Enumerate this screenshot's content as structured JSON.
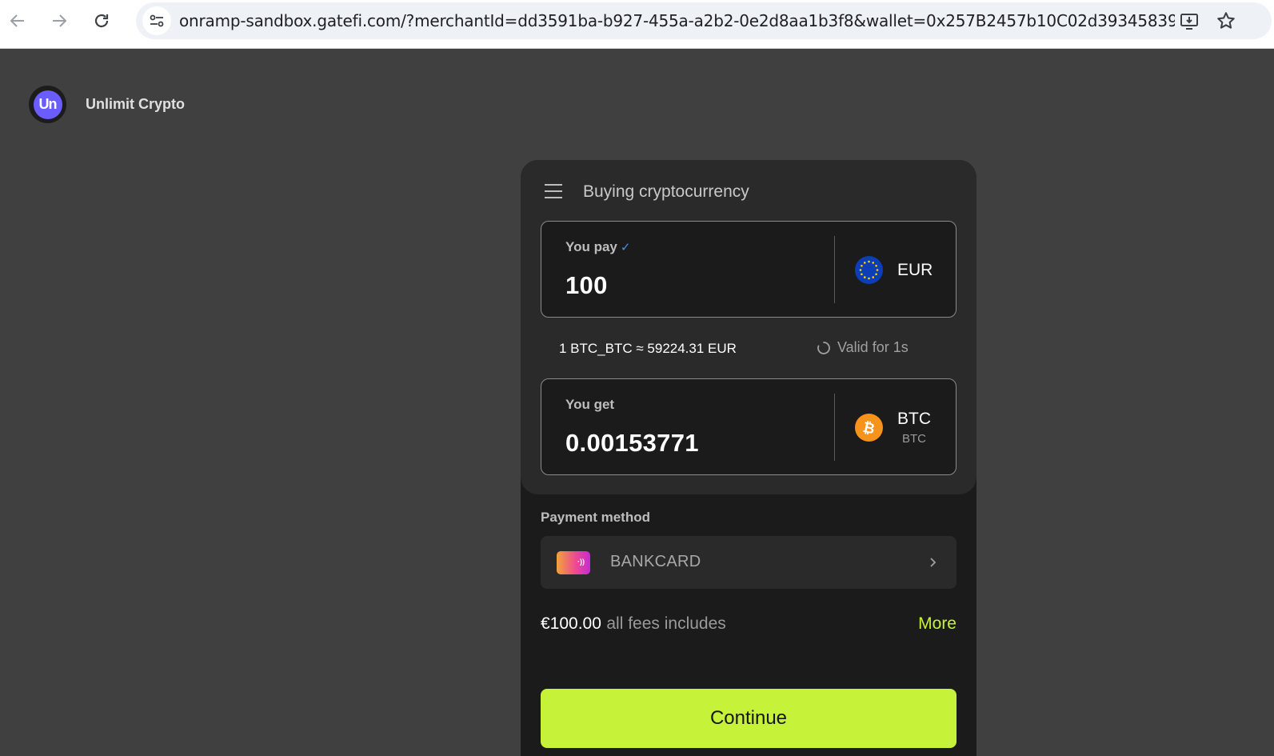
{
  "browser": {
    "url": "onramp-sandbox.gatefi.com/?merchantId=dd3591ba-b927-455a-a2b2-0e2d8aa1b3f8&wallet=0x257B2457b10C02d393458393515F51..."
  },
  "brand": {
    "logo_text": "Un",
    "name": "Unlimit Crypto"
  },
  "widget": {
    "title": "Buying cryptocurrency",
    "pay": {
      "label": "You pay",
      "check": "✓",
      "value": "100",
      "currency": "EUR"
    },
    "rate": {
      "text": "1 BTC_BTC ≈ 59224.31 EUR",
      "valid": "Valid for 1s"
    },
    "get": {
      "label": "You get",
      "value": "0.00153771",
      "currency": "BTC",
      "network": "BTC"
    },
    "payment_method": {
      "label": "Payment method",
      "name": "BANKCARD"
    },
    "fees": {
      "amount": "€100.00",
      "text": "all fees includes",
      "more": "More"
    },
    "continue_label": "Continue"
  },
  "colors": {
    "accent": "#c6f23a",
    "brand": "#6b5cff",
    "btc": "#f7931a",
    "eur": "#0d3eb8"
  }
}
